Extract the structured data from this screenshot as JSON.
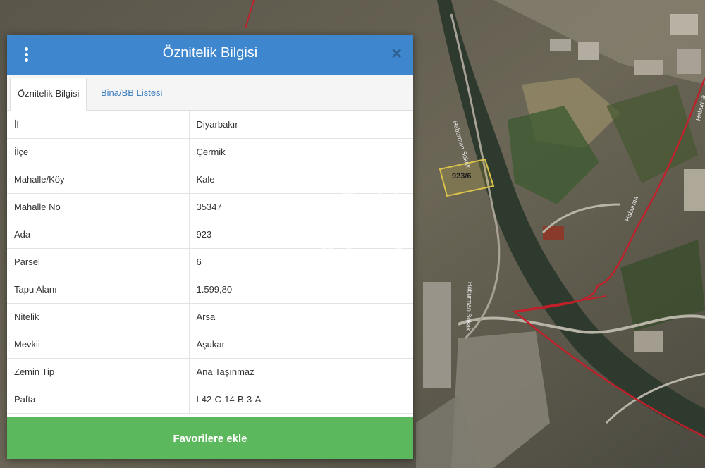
{
  "map": {
    "parcel_label": "923/6",
    "streets": [
      "Haburman Sokak",
      "Haburman Sokak",
      "Haburma",
      "Haburma"
    ]
  },
  "panel": {
    "title": "Öznitelik Bilgisi",
    "close_glyph": "✕",
    "tabs": [
      {
        "label": "Öznitelik Bilgisi",
        "active": true
      },
      {
        "label": "Bina/BB Listesi",
        "active": false
      }
    ],
    "rows": [
      {
        "key": "İl",
        "value": "Diyarbakır"
      },
      {
        "key": "İlçe",
        "value": "Çermik"
      },
      {
        "key": "Mahalle/Köy",
        "value": "Kale"
      },
      {
        "key": "Mahalle No",
        "value": "35347"
      },
      {
        "key": "Ada",
        "value": "923"
      },
      {
        "key": "Parsel",
        "value": "6"
      },
      {
        "key": "Tapu Alanı",
        "value": "1.599,80"
      },
      {
        "key": "Nitelik",
        "value": "Arsa"
      },
      {
        "key": "Mevkii",
        "value": "Aşukar"
      },
      {
        "key": "Zemin Tip",
        "value": "Ana Taşınmaz"
      },
      {
        "key": "Pafta",
        "value": "L42-C-14-B-3-A"
      }
    ],
    "favorite_button": "Favorilere ekle"
  },
  "colors": {
    "header": "#3e87cf",
    "button": "#5cb85c",
    "tab_link": "#3e7fc1",
    "boundary": "#c0202a",
    "parcel_outline": "#d8c24a"
  }
}
